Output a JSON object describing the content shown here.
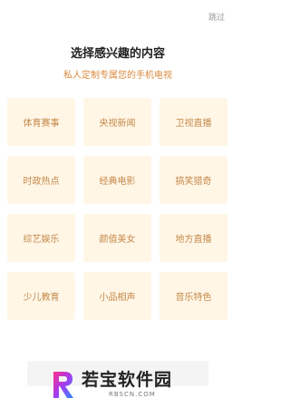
{
  "header": {
    "skip_label": "跳过",
    "title": "选择感兴趣的内容",
    "subtitle": "私人定制专属您的手机电视"
  },
  "interests": [
    {
      "label": "体育赛事"
    },
    {
      "label": "央视新闻"
    },
    {
      "label": "卫视直播"
    },
    {
      "label": "时政热点"
    },
    {
      "label": "经典电影"
    },
    {
      "label": "搞笑猎奇"
    },
    {
      "label": "综艺娱乐"
    },
    {
      "label": "颜值美女"
    },
    {
      "label": "地方直播"
    },
    {
      "label": "少儿教育"
    },
    {
      "label": "小品相声"
    },
    {
      "label": "音乐特色"
    }
  ],
  "watermark": {
    "name": "若宝软件园",
    "url": "RBSCN.COM"
  },
  "colors": {
    "tile_bg": "#fff6e6",
    "tile_text": "#c5894a",
    "subtitle": "#d9893d"
  }
}
